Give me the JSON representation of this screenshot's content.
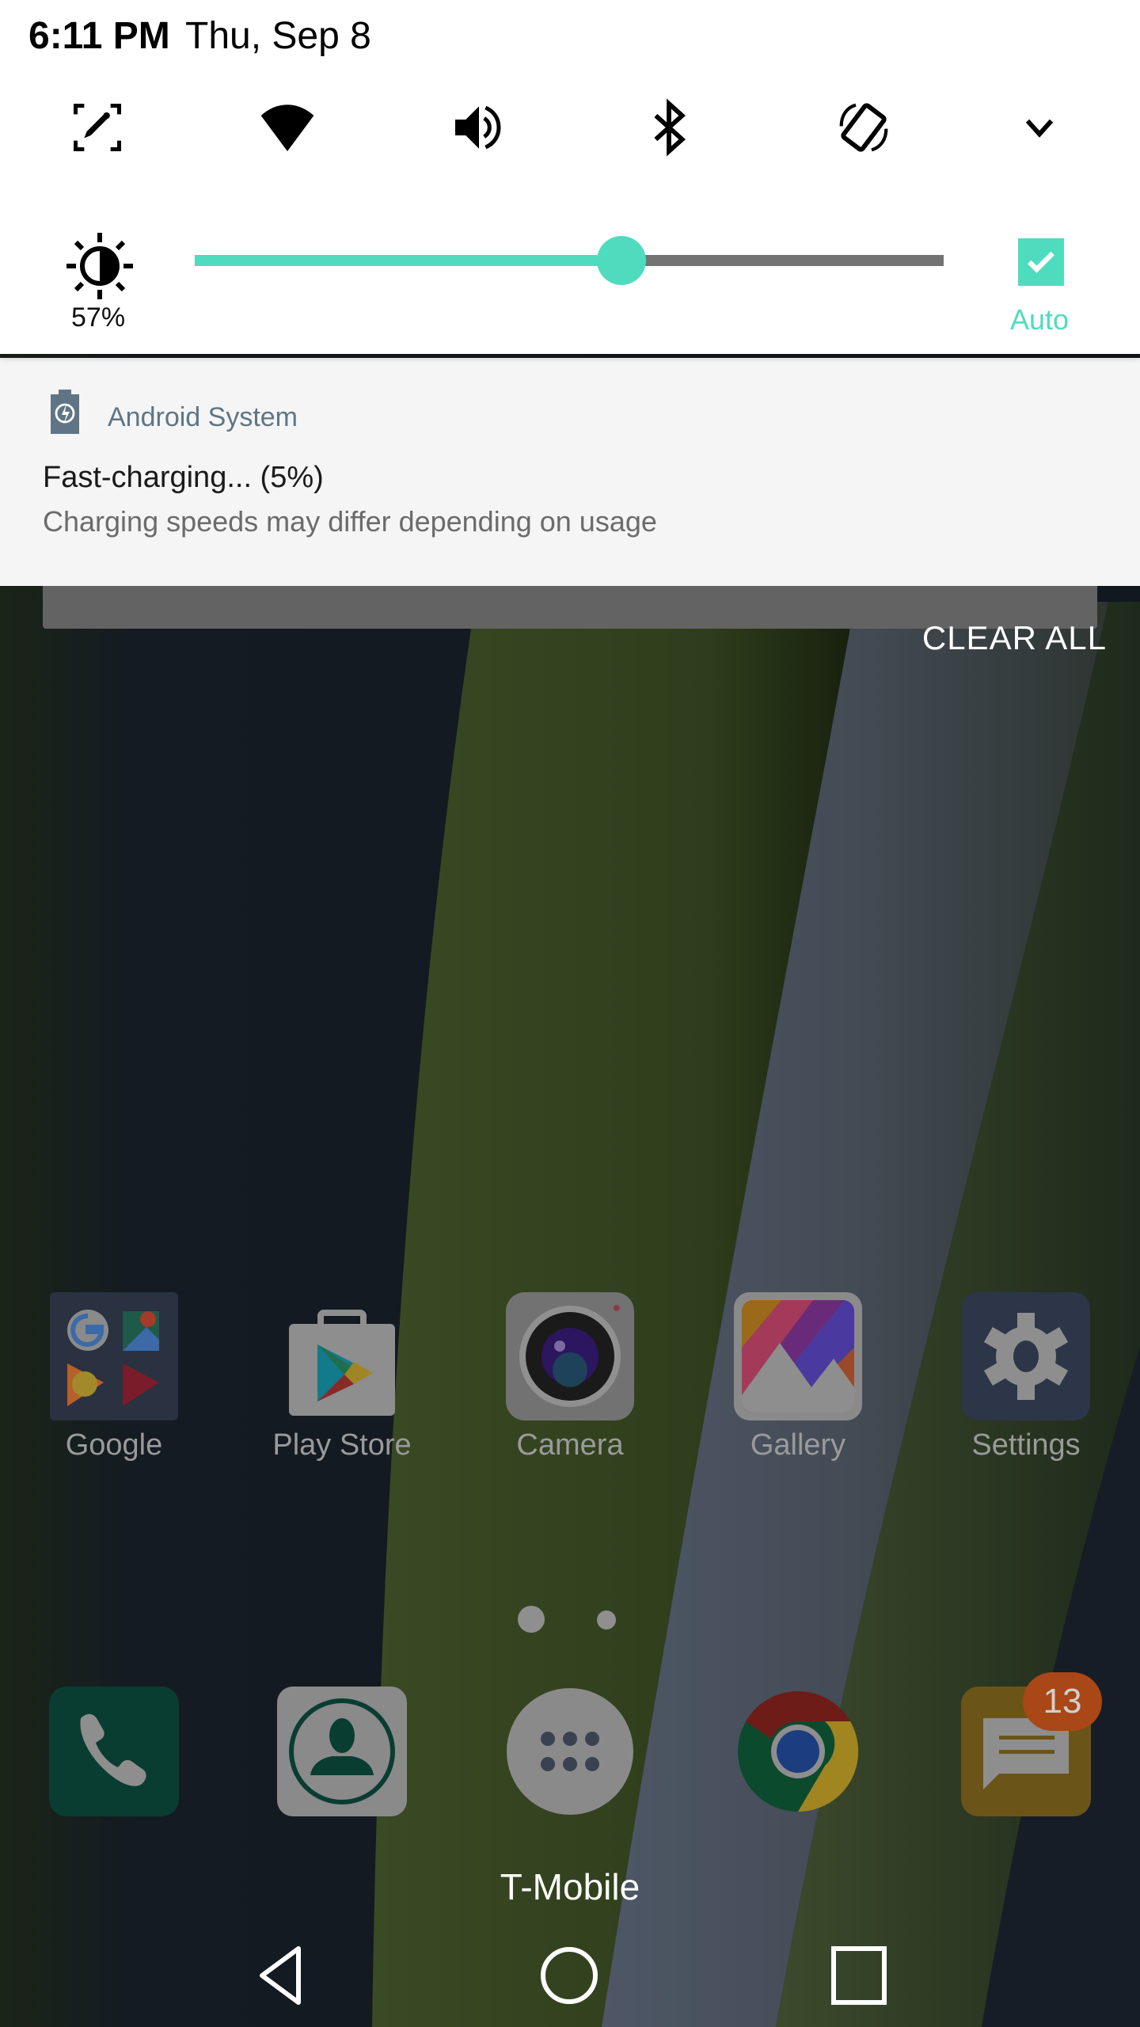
{
  "status": {
    "time": "6:11 PM",
    "date": "Thu, Sep 8"
  },
  "quick_tiles": [
    {
      "name": "screen-capture",
      "icon": "capture-edit-icon",
      "active": true
    },
    {
      "name": "wifi",
      "icon": "wifi-icon",
      "active": true
    },
    {
      "name": "sound",
      "icon": "volume-icon",
      "active": true
    },
    {
      "name": "bluetooth",
      "icon": "bluetooth-icon",
      "active": true
    },
    {
      "name": "auto-rotate",
      "icon": "rotate-icon",
      "active": true
    },
    {
      "name": "expand",
      "icon": "chevron-down-icon",
      "active": false
    }
  ],
  "brightness": {
    "percent_label": "57%",
    "level": 0.57,
    "auto_label": "Auto",
    "auto_checked": true,
    "accent": "#4fdcbe",
    "track_color": "#737373"
  },
  "notification": {
    "app_name": "Android System",
    "title": "Fast-charging... (5%)",
    "body": "Charging speeds may differ depending on usage",
    "icon": "battery-charging-icon"
  },
  "clear_all_label": "CLEAR ALL",
  "home_apps": [
    {
      "label": "Google",
      "icon": "google-folder-icon"
    },
    {
      "label": "Play Store",
      "icon": "play-store-icon"
    },
    {
      "label": "Camera",
      "icon": "camera-icon"
    },
    {
      "label": "Gallery",
      "icon": "gallery-icon"
    },
    {
      "label": "Settings",
      "icon": "settings-gear-icon"
    }
  ],
  "page_indicator": {
    "pages": 2,
    "current": 1
  },
  "dock": [
    {
      "name": "phone",
      "icon": "phone-icon"
    },
    {
      "name": "contacts",
      "icon": "contacts-icon"
    },
    {
      "name": "app-drawer",
      "icon": "app-drawer-icon"
    },
    {
      "name": "chrome",
      "icon": "chrome-icon"
    },
    {
      "name": "messages",
      "icon": "messages-icon",
      "badge": "13"
    }
  ],
  "carrier": "T-Mobile",
  "nav": {
    "back": "back-icon",
    "home": "home-icon",
    "recents": "recents-icon"
  }
}
